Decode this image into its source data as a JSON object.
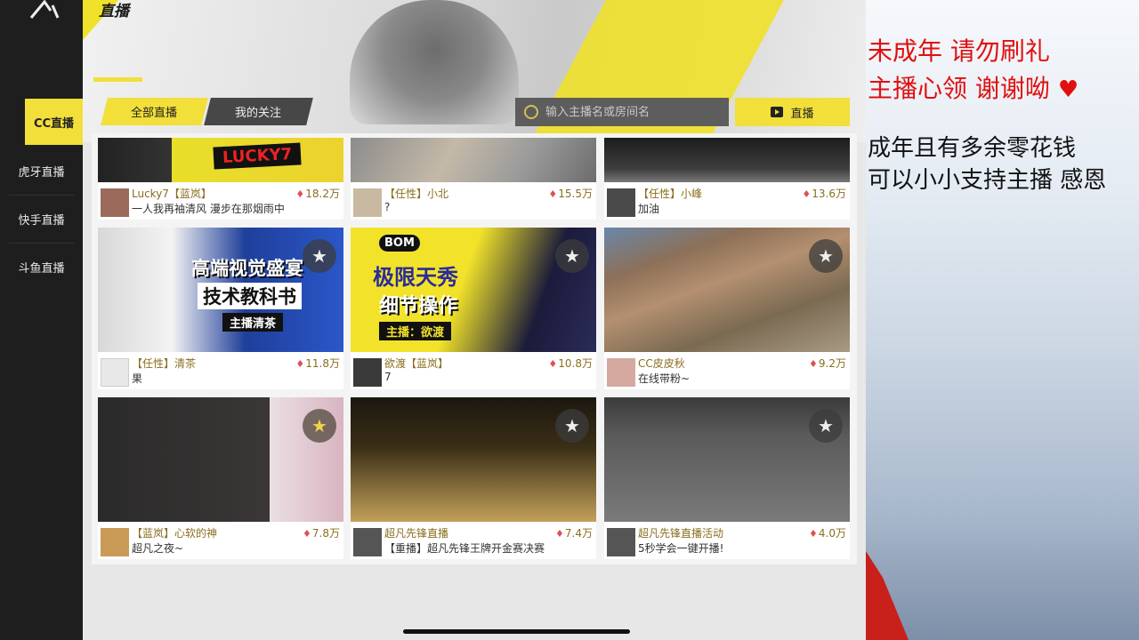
{
  "app": {
    "page_title": "直播"
  },
  "sidebar": {
    "items": [
      {
        "label": "CC直播",
        "active": true
      },
      {
        "label": "虎牙直播",
        "active": false
      },
      {
        "label": "快手直播",
        "active": false
      },
      {
        "label": "斗鱼直播",
        "active": false
      }
    ]
  },
  "tabs": [
    {
      "label": "全部直播",
      "active": true
    },
    {
      "label": "我的关注",
      "active": false
    }
  ],
  "search": {
    "placeholder": "输入主播名或房间名"
  },
  "live_button": {
    "label": "直播"
  },
  "streams": [
    {
      "streamer": "Lucky7【蓝岚】",
      "room": "一人我再袖清风 漫步在那烟雨中",
      "heat": "18.2万",
      "thumb_text": "LUCKY7"
    },
    {
      "streamer": "【任性】小北",
      "room": "?",
      "heat": "15.5万"
    },
    {
      "streamer": "【任性】小峰",
      "room": "加油",
      "heat": "13.6万"
    },
    {
      "streamer": "【任性】清茶",
      "room": "果",
      "heat": "11.8万",
      "thumb_text": [
        "高端视觉盛宴",
        "技术教科书",
        "主播清茶"
      ]
    },
    {
      "streamer": "欲渡【蓝岚】",
      "room": "7",
      "heat": "10.8万",
      "thumb_text": [
        "BOM",
        "极限天秀",
        "细节操作",
        "主播：欲渡"
      ]
    },
    {
      "streamer": "CC皮皮秋",
      "room": "在线带粉~",
      "heat": "9.2万"
    },
    {
      "streamer": "【蓝岚】心软的神",
      "room": "超凡之夜~",
      "heat": "7.8万"
    },
    {
      "streamer": "超凡先锋直播",
      "room": "【重播】超凡先锋王牌开金赛决赛",
      "heat": "7.4万"
    },
    {
      "streamer": "超凡先锋直播活动",
      "room": "5秒学会一键开播!",
      "heat": "4.0万"
    }
  ],
  "overlay": {
    "line1": "未成年 请勿刷礼",
    "line2": "主播心领 谢谢呦",
    "line3": "成年且有多余零花钱",
    "line4": "可以小小支持主播 感恩"
  },
  "colors": {
    "accent": "#f2df3a",
    "sidebar": "#1e1e1e",
    "notice_red": "#e01010"
  }
}
